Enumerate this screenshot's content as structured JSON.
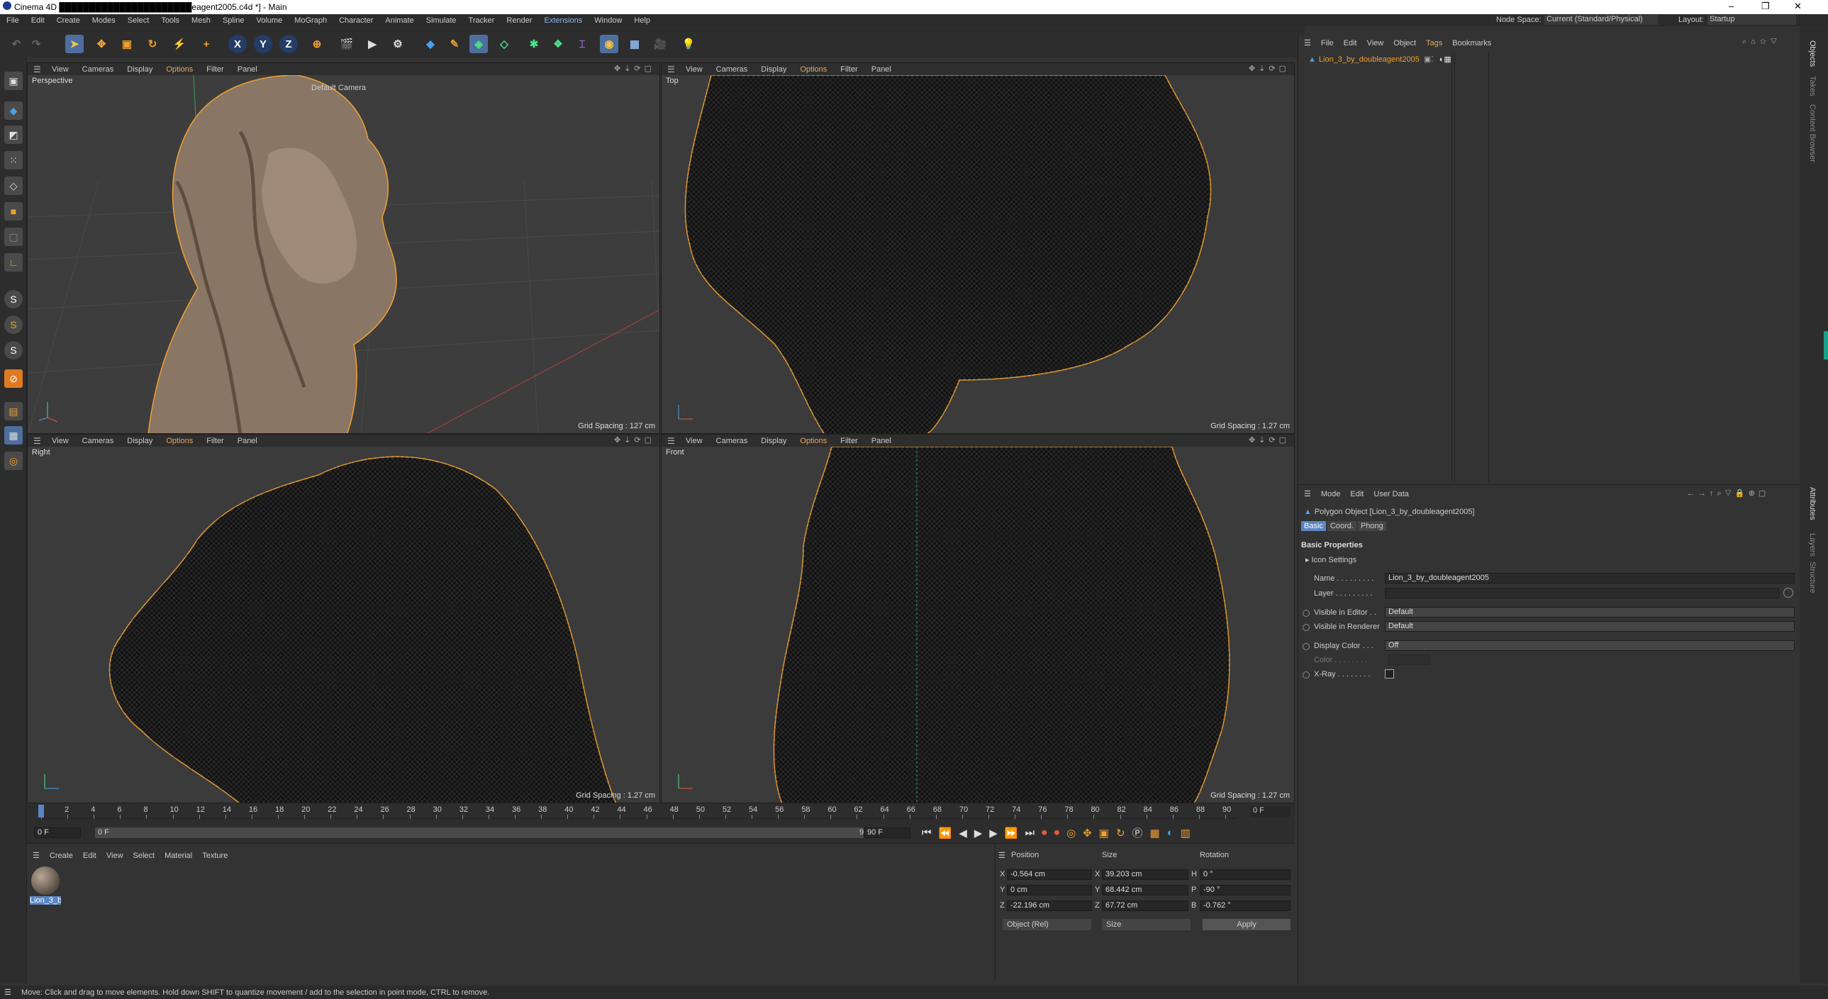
{
  "window": {
    "title": "Cinema 4D ██████████████████████eagent2005.c4d *] - Main",
    "controls": [
      "–",
      "❐",
      "✕"
    ]
  },
  "menubar": [
    "File",
    "Edit",
    "Create",
    "Modes",
    "Select",
    "Tools",
    "Mesh",
    "Spline",
    "Volume",
    "MoGraph",
    "Character",
    "Animate",
    "Simulate",
    "Tracker",
    "Render",
    "Extensions",
    "Window",
    "Help"
  ],
  "node_space": {
    "label": "Node Space:",
    "value": "Current (Standard/Physical)"
  },
  "layout": {
    "label": "Layout:",
    "value": "Startup"
  },
  "toolbar": {
    "axis_x": "X",
    "axis_y": "Y",
    "axis_z": "Z"
  },
  "viewports": {
    "menu": [
      "View",
      "Cameras",
      "Display",
      "Options",
      "Filter",
      "Panel"
    ],
    "perspective": {
      "name": "Perspective",
      "camera": "Default Camera",
      "grid": "Grid Spacing : 127 cm"
    },
    "top": {
      "name": "Top",
      "grid": "Grid Spacing : 1.27 cm"
    },
    "right": {
      "name": "Right",
      "grid": "Grid Spacing : 1.27 cm"
    },
    "front": {
      "name": "Front",
      "grid": "Grid Spacing : 1.27 cm"
    }
  },
  "timeline": {
    "ticks": [
      "0",
      "2",
      "4",
      "6",
      "8",
      "10",
      "12",
      "14",
      "16",
      "18",
      "20",
      "22",
      "24",
      "26",
      "28",
      "30",
      "32",
      "34",
      "36",
      "38",
      "40",
      "42",
      "44",
      "46",
      "48",
      "50",
      "52",
      "54",
      "56",
      "58",
      "60",
      "62",
      "64",
      "66",
      "68",
      "70",
      "72",
      "74",
      "76",
      "78",
      "80",
      "82",
      "84",
      "86",
      "88",
      "90"
    ],
    "current_frame": "0 F",
    "start": "0 F",
    "range_start": "0 F",
    "range_end": "90 F",
    "end": "90 F"
  },
  "materials": {
    "menu": [
      "Create",
      "Edit",
      "View",
      "Select",
      "Material",
      "Texture"
    ],
    "items": [
      {
        "label": "Lion_3_b"
      }
    ]
  },
  "coords": {
    "headers": [
      "Position",
      "Size",
      "Rotation"
    ],
    "rows": [
      {
        "axis": "X",
        "pos": "-0.564 cm",
        "size_axis": "X",
        "size": "39.203 cm",
        "rot_axis": "H",
        "rot": "0 °"
      },
      {
        "axis": "Y",
        "pos": "0 cm",
        "size_axis": "Y",
        "size": "68.442 cm",
        "rot_axis": "P",
        "rot": "-90 °"
      },
      {
        "axis": "Z",
        "pos": "-22.196 cm",
        "size_axis": "Z",
        "size": "67.72 cm",
        "rot_axis": "B",
        "rot": "-0.762 °"
      }
    ],
    "mode": "Object (Rel)",
    "size_mode": "Size",
    "apply": "Apply"
  },
  "objects": {
    "menu": [
      "File",
      "Edit",
      "View",
      "Object",
      "Tags",
      "Bookmarks"
    ],
    "items": [
      {
        "name": "Lion_3_by_doubleagent2005"
      }
    ]
  },
  "attributes": {
    "menu": [
      "Mode",
      "Edit",
      "User Data"
    ],
    "object_title": "Polygon Object [Lion_3_by_doubleagent2005]",
    "tabs": [
      "Basic",
      "Coord.",
      "Phong"
    ],
    "section": "Basic Properties",
    "icon_settings": "Icon Settings",
    "fields": {
      "name_label": "Name . . . . . . . . .",
      "name_value": "Lion_3_by_doubleagent2005",
      "layer_label": "Layer . . . . . . . . .",
      "vis_editor_label": "Visible in Editor . .",
      "vis_editor_value": "Default",
      "vis_render_label": "Visible in Renderer",
      "vis_render_value": "Default",
      "display_color_label": "Display Color . . .",
      "display_color_value": "Off",
      "color_label": "Color . . . . . . . .",
      "xray_label": "X-Ray . . . . . . . ."
    }
  },
  "right_strip_tabs": [
    "Objects",
    "Takes",
    "Content Browser",
    "Attributes",
    "Layers",
    "Structure"
  ],
  "status": "Move: Click and drag to move elements. Hold down SHIFT to quantize movement / add to the selection in point mode, CTRL to remove.",
  "colors": {
    "accent_orange": "#e6a85a",
    "selection_blue": "#5a86c5",
    "object_orange": "#f0a030"
  }
}
